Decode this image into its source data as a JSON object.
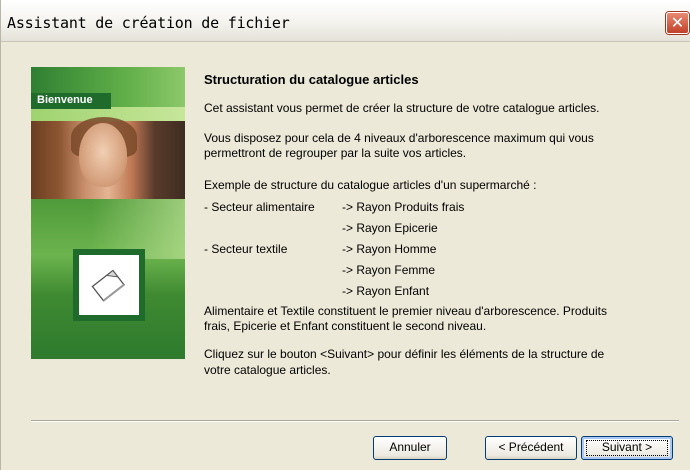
{
  "window": {
    "title": "Assistant de création de fichier",
    "close_symbol": "✕"
  },
  "side_panel": {
    "badge": "Bienvenue",
    "colors": {
      "primary_green": "#1f6b2b",
      "light_green": "#9fd36f"
    }
  },
  "main": {
    "heading": "Structuration du catalogue articles",
    "intro": "Cet assistant vous permet de créer la structure de votre catalogue articles.",
    "levels_line1": "Vous disposez pour cela de 4 niveaux d'arborescence maximum qui vous",
    "levels_line2": "permettront de regrouper par la suite vos articles.",
    "example_title": "Exemple de structure du catalogue articles d'un supermarché :",
    "example_rows": [
      {
        "left": "- Secteur alimentaire",
        "right": "-> Rayon Produits frais"
      },
      {
        "left": "",
        "right": "-> Rayon Epicerie"
      },
      {
        "left": "- Secteur textile",
        "right": "-> Rayon Homme"
      },
      {
        "left": "",
        "right": "-> Rayon Femme"
      },
      {
        "left": "",
        "right": "-> Rayon Enfant"
      }
    ],
    "levels_expl_line1": "Alimentaire et Textile constituent le premier niveau d'arborescence. Produits",
    "levels_expl_line2": "frais, Epicerie et Enfant constituent le second niveau.",
    "next_expl_line1": "Cliquez sur le bouton <Suivant> pour définir les éléments de la structure de",
    "next_expl_line2": "votre catalogue articles."
  },
  "buttons": {
    "cancel": "Annuler",
    "previous": "< Précédent",
    "next": "Suivant >"
  },
  "icons": {
    "close": "close-icon",
    "document": "document-icon"
  }
}
